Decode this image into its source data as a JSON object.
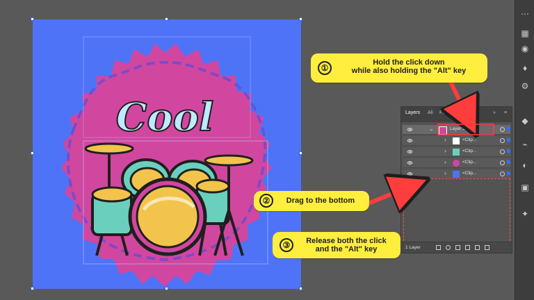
{
  "callouts": [
    {
      "number": "①",
      "line1": "Hold the click down",
      "line2": "while also holding the \"Alt\" key"
    },
    {
      "number": "②",
      "line1": "Drag to the bottom",
      "line2": ""
    },
    {
      "number": "③",
      "line1": "Release both the click",
      "line2": "and the \"Alt\" key"
    }
  ],
  "artwork": {
    "title": "Cool"
  },
  "layers_panel": {
    "tabs": [
      "Layers",
      "Ali",
      "Pat",
      "Ima",
      "Ass",
      "»"
    ],
    "rows": [
      {
        "label": "Layer 1"
      },
      {
        "label": "<Clip..."
      },
      {
        "label": "<Clip..."
      },
      {
        "label": "<Clip..."
      },
      {
        "label": "<Clip..."
      }
    ],
    "footer": "1 Layer"
  },
  "toolbar": {
    "icons": [
      "options-icon",
      "document-icon",
      "layers-icon",
      "appearance-icon",
      "layers-panel-icon",
      "symbol-icon",
      "brush-icon",
      "gradient-icon",
      "swatches-icon",
      "transparency-icon"
    ]
  },
  "colors": {
    "artboard": "#4f73f7",
    "callout": "#ffee3e",
    "accent": "#ff3d3d",
    "badge_pink": "#d1479f"
  }
}
